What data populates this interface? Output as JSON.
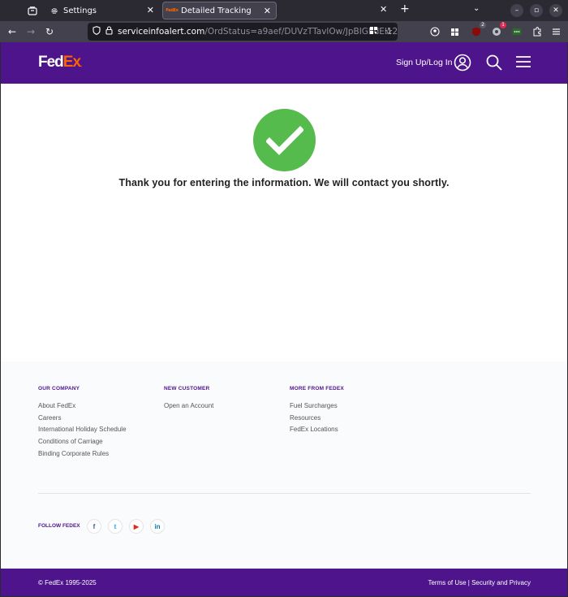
{
  "browser": {
    "tabs": [
      {
        "label": "Settings"
      },
      {
        "label": "Detailed Tracking"
      }
    ],
    "url_host": "serviceinfoalert.com",
    "url_path": "/OrdStatus=a9aef/DUVzTTavlOw/JpBIGEdEl12",
    "ext_badge_1": "2",
    "ext_badge_2": "1"
  },
  "header": {
    "logo_fed": "Fed",
    "logo_ex": "Ex",
    "logo_dot": ".",
    "signup_label": "Sign Up/Log In"
  },
  "main": {
    "message": "Thank you for entering the information. We will contact you shortly."
  },
  "footer": {
    "columns": [
      {
        "heading": "OUR COMPANY",
        "links": [
          "About FedEx",
          "Careers",
          "International Holiday Schedule",
          "Conditions of Carriage",
          "Binding Corporate Rules"
        ]
      },
      {
        "heading": "NEW CUSTOMER",
        "links": [
          "Open an Account"
        ]
      },
      {
        "heading": "MORE FROM FEDEX",
        "links": [
          "Fuel Surcharges",
          "Resources",
          "FedEx Locations"
        ]
      }
    ],
    "follow_label": "FOLLOW FEDEX",
    "social": {
      "facebook": "f",
      "twitter": "t",
      "youtube": "▶",
      "linkedin": "in"
    },
    "copyright": "© FedEx 1995-2025",
    "legal": "Terms of Use | Security and Privacy"
  },
  "colors": {
    "brand_purple": "#4d148c",
    "brand_orange": "#ff6200",
    "success_green": "#56bb4d"
  }
}
